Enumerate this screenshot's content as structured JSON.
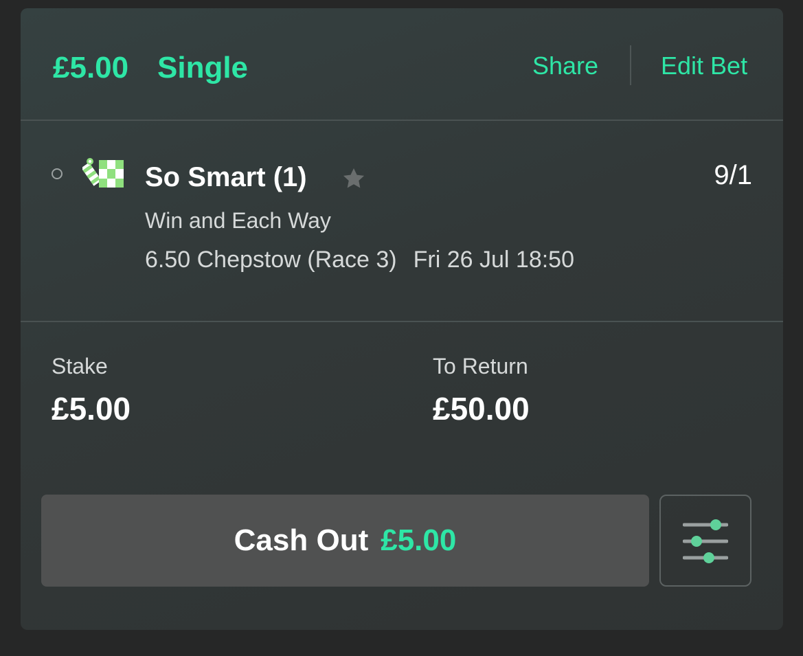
{
  "header": {
    "stake_amount": "£5.00",
    "bet_type": "Single",
    "share_label": "Share",
    "edit_label": "Edit Bet"
  },
  "selection": {
    "runner_name": "So Smart (1)",
    "odds": "9/1",
    "market": "Win and Each Way",
    "event_name": "6.50 Chepstow (Race 3)",
    "event_time": "Fri 26 Jul 18:50",
    "silks_icon": "jockey-silks-icon",
    "favourite_icon": "star-icon"
  },
  "summary": {
    "stake_label": "Stake",
    "stake_value": "£5.00",
    "return_label": "To Return",
    "return_value": "£50.00"
  },
  "cashout": {
    "label": "Cash Out",
    "amount": "£5.00",
    "settings_icon": "sliders-icon"
  },
  "colors": {
    "accent": "#2ee6a6",
    "background": "#262727",
    "card": "#323838",
    "button": "#505151"
  }
}
